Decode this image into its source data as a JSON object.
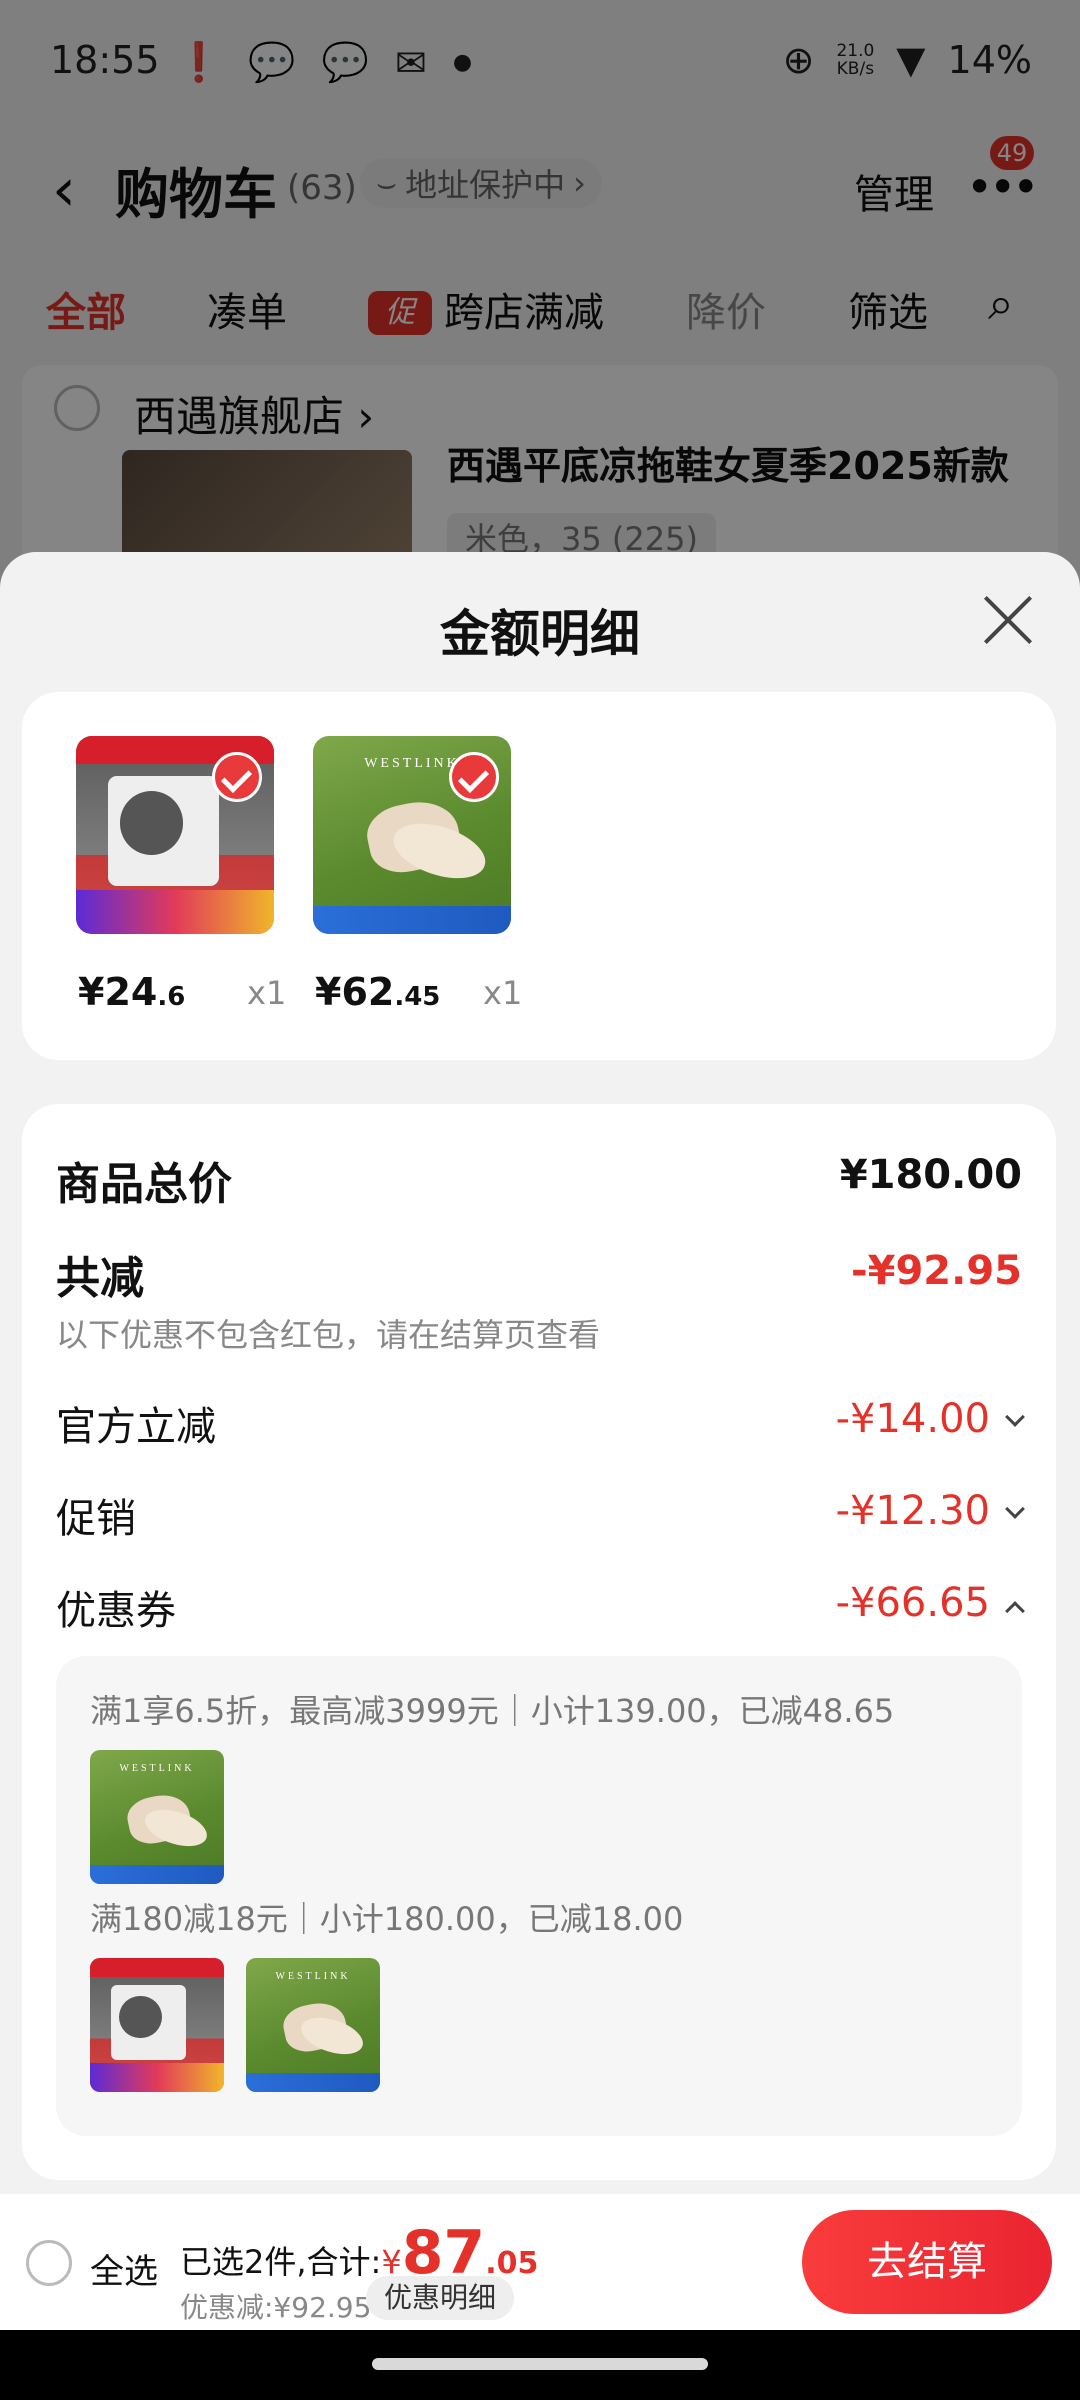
{
  "status_bar": {
    "time": "18:55",
    "speed_value": "21.0",
    "speed_unit": "KB/s",
    "battery": "14%"
  },
  "header": {
    "back_icon": "‹",
    "title": "购物车",
    "count": "(63)",
    "address_protect": "地址保护中",
    "manage": "管理",
    "more_badge": "49"
  },
  "tabs": [
    {
      "label": "全部",
      "active": true
    },
    {
      "label": "凑单"
    },
    {
      "label": "跨店满减",
      "tag": "促"
    },
    {
      "label": "降价"
    },
    {
      "label": "筛选"
    }
  ],
  "store": {
    "name": "西遇旗舰店",
    "product_title": "西遇平底凉拖鞋女夏季2025新款",
    "sku": "米色，35 (225)"
  },
  "sheet": {
    "title": "金额明细",
    "products": [
      {
        "price_int": "¥24",
        "price_dec": ".6",
        "qty": "x1",
        "image": "panel-socket"
      },
      {
        "price_int": "¥62",
        "price_dec": ".45",
        "qty": "x1",
        "image": "sandal"
      }
    ],
    "totals": {
      "total_label": "商品总价",
      "total_value": "¥180.00",
      "reduce_label": "共减",
      "reduce_value": "-¥92.95",
      "note": "以下优惠不包含红包，请在结算页查看",
      "rows": [
        {
          "label": "官方立减",
          "value": "-¥14.00",
          "expanded": false
        },
        {
          "label": "促销",
          "value": "-¥12.30",
          "expanded": false
        },
        {
          "label": "优惠券",
          "value": "-¥66.65",
          "expanded": true
        }
      ],
      "coupons": [
        {
          "text": "满1享6.5折，最高减3999元｜小计139.00，已减48.65"
        },
        {
          "text": "满180减18元｜小计180.00，已减18.00"
        }
      ]
    }
  },
  "bottom": {
    "select_all": "全选",
    "selected_text": "已选2件,合计:",
    "yen": "¥",
    "total_int": "87",
    "total_dec": ".05",
    "discount": "优惠减:¥92.95",
    "detail": "优惠明细",
    "checkout": "去结算"
  },
  "colors": {
    "accent": "#e4322b",
    "checkout": "#f93c3c"
  }
}
